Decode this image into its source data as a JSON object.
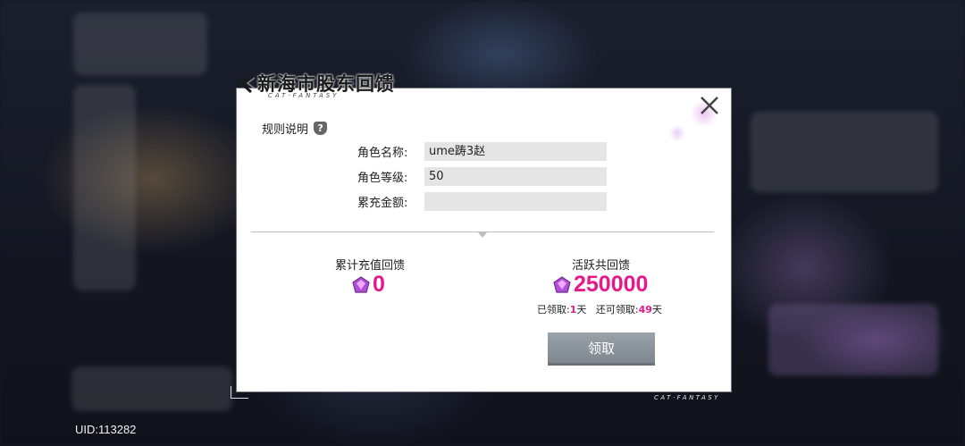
{
  "uid_label": "UID:113282",
  "modal": {
    "title": "新海市股东回馈",
    "title_sub": "CAT·FANTASY",
    "rules_label": "规则说明",
    "help_icon_text": "?",
    "fields": [
      {
        "label": "角色名称:",
        "value": "ume踌3赵"
      },
      {
        "label": "角色等级:",
        "value": "50"
      },
      {
        "label": "累充金额:",
        "value": ""
      }
    ],
    "recharge": {
      "title": "累计充值回馈",
      "value": "0"
    },
    "active": {
      "title": "活跃共回馈",
      "value": "250000"
    },
    "claimed_prefix": "已领取:",
    "claimed_days": "1",
    "claimed_unit": "天",
    "remaining_prefix": "还可领取:",
    "remaining_days": "49",
    "remaining_unit": "天",
    "claim_button": "领取"
  },
  "footer_brand": "CAT·FANTASY",
  "colors": {
    "accent": "#e8178a",
    "button": "#8a9298",
    "field_bg": "#e5e5e5"
  },
  "icons": [
    "chevron-left-icon",
    "close-icon",
    "help-icon",
    "gem-icon"
  ]
}
